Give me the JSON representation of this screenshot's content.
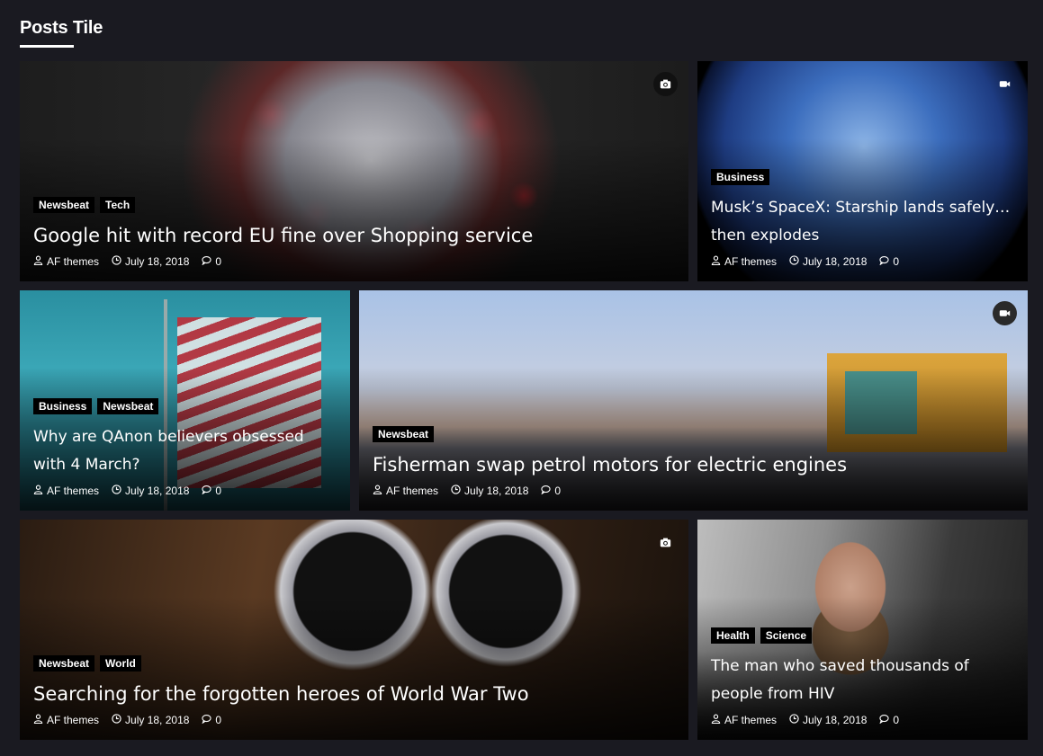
{
  "section": {
    "title": "Posts Tile"
  },
  "posts": [
    {
      "categories": [
        "Newsbeat",
        "Tech"
      ],
      "title": "Google hit with record EU fine over Shopping service",
      "author": "AF themes",
      "date": "July 18, 2018",
      "comments": "0",
      "format_icon": "camera-icon"
    },
    {
      "categories": [
        "Business"
      ],
      "title": "Musk’s SpaceX: Starship lands safely… then explodes",
      "author": "AF themes",
      "date": "July 18, 2018",
      "comments": "0",
      "format_icon": "video-icon"
    },
    {
      "categories": [
        "Business",
        "Newsbeat"
      ],
      "title": "Why are QAnon believers obsessed with 4 March?",
      "author": "AF themes",
      "date": "July 18, 2018",
      "comments": "0"
    },
    {
      "categories": [
        "Newsbeat"
      ],
      "title": "Fisherman swap petrol motors for electric engines",
      "author": "AF themes",
      "date": "July 18, 2018",
      "comments": "0",
      "format_icon": "video-icon"
    },
    {
      "categories": [
        "Newsbeat",
        "World"
      ],
      "title": "Searching for the forgotten heroes of World War Two",
      "author": "AF themes",
      "date": "July 18, 2018",
      "comments": "0",
      "format_icon": "camera-icon"
    },
    {
      "categories": [
        "Health",
        "Science"
      ],
      "title": "The man who saved thousands of people from HIV",
      "author": "AF themes",
      "date": "July 18, 2018",
      "comments": "0"
    }
  ]
}
